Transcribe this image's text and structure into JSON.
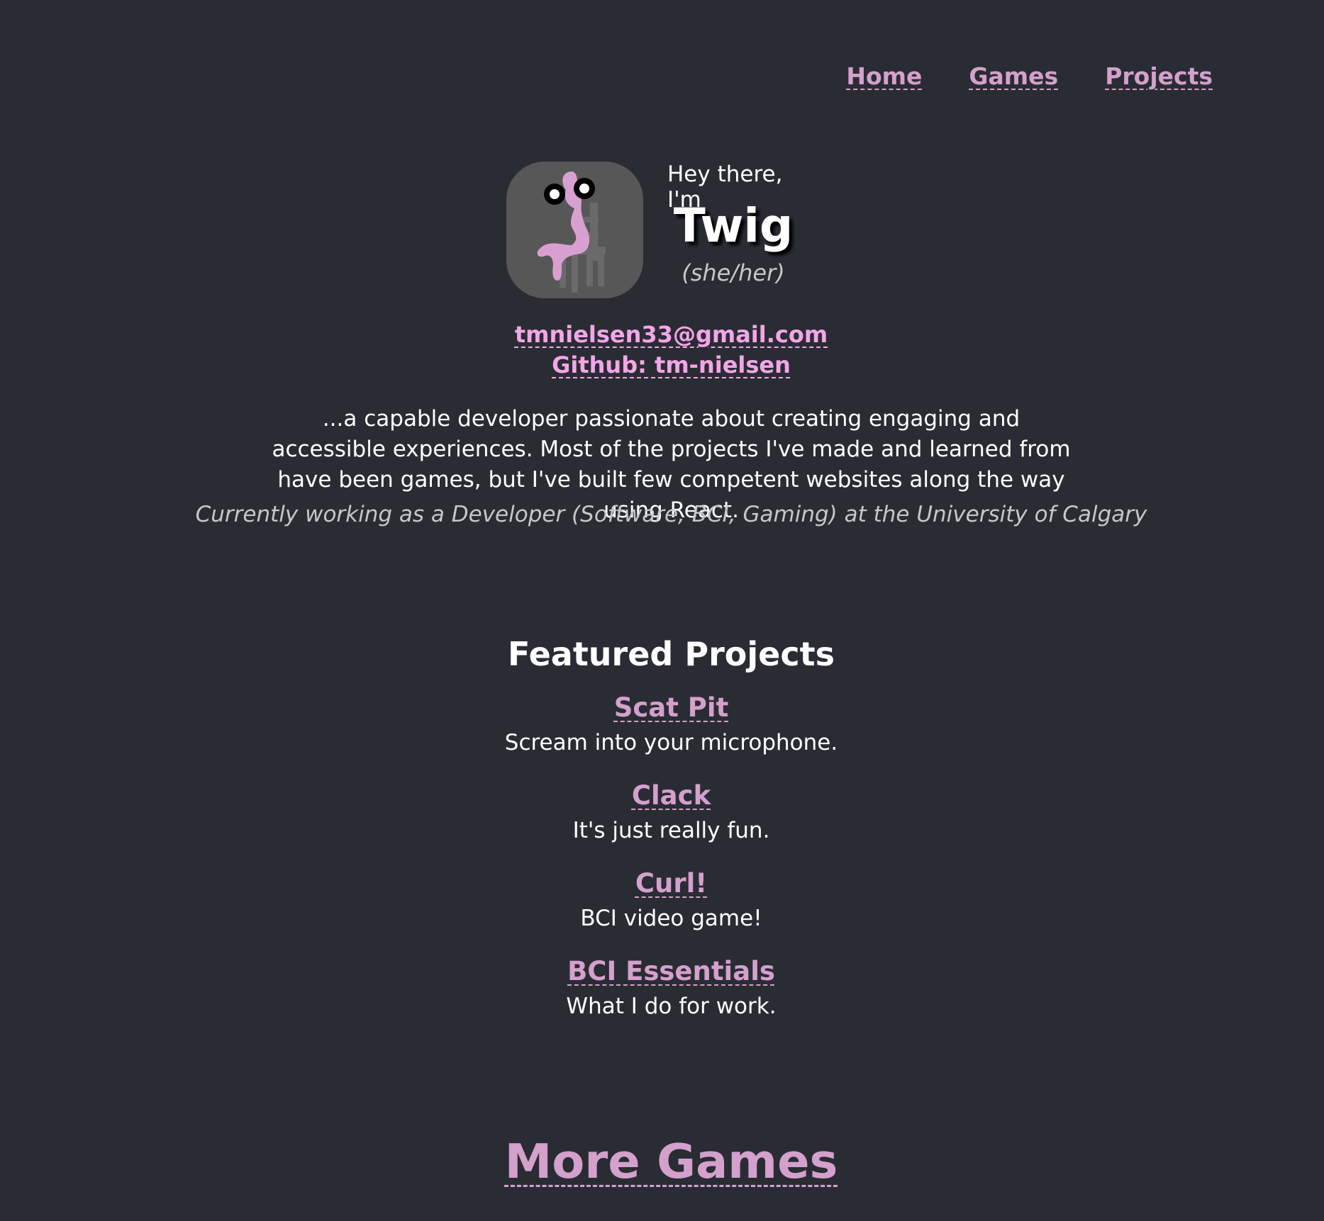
{
  "nav": {
    "items": [
      {
        "label": "Home"
      },
      {
        "label": "Games"
      },
      {
        "label": "Projects"
      }
    ]
  },
  "hero": {
    "greeting": "Hey there, I'm",
    "name": "Twig",
    "pronouns": "(she/her)"
  },
  "contact": {
    "email": "tmnielsen33@gmail.com",
    "github": "Github: tm-nielsen"
  },
  "bio": {
    "text": "...a capable developer passionate about creating engaging and accessible experiences. Most of the projects I've made and learned from have been games, but I've built few competent websites along the way using React.",
    "status": "Currently working as a Developer (Software, BCI, Gaming) at the University of Calgary"
  },
  "featured": {
    "heading": "Featured Projects",
    "projects": [
      {
        "title": "Scat Pit",
        "description": "Scream into your microphone."
      },
      {
        "title": "Clack",
        "description": "It's just really fun."
      },
      {
        "title": "Curl!",
        "description": "BCI video game!"
      },
      {
        "title": "BCI Essentials",
        "description": "What I do for work."
      }
    ]
  },
  "more_games": "More Games",
  "colors": {
    "background": "#2a2c34",
    "link": "#d4a0cc",
    "contact_link": "#f3a6e6",
    "muted": "#c7c7c7"
  },
  "icons": {
    "avatar": "pink-figure-on-chair-avatar"
  }
}
